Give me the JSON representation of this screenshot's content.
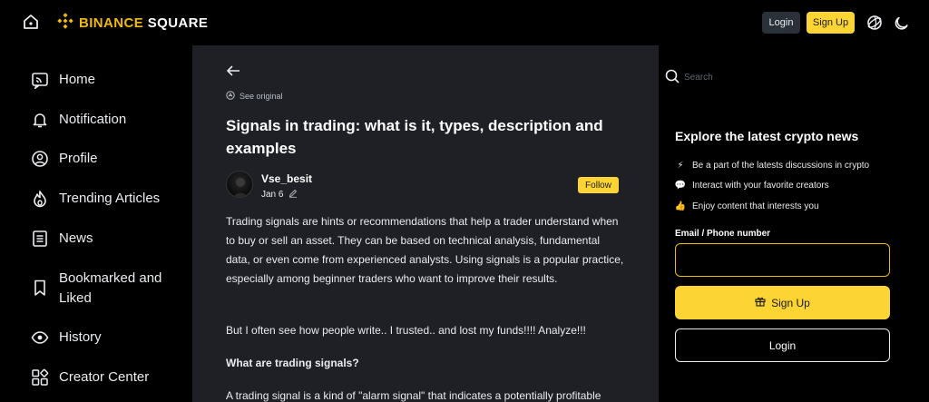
{
  "header": {
    "logo_brand": "BINANCE",
    "logo_product": "SQUARE",
    "login_label": "Login",
    "signup_label": "Sign Up",
    "icons": [
      "home-icon",
      "binance-logo-icon",
      "globe-icon",
      "moon-icon"
    ]
  },
  "sidebar": {
    "items": [
      {
        "label": "Home",
        "icon": "home-feed-icon"
      },
      {
        "label": "Notification",
        "icon": "bell-icon"
      },
      {
        "label": "Profile",
        "icon": "user-icon"
      },
      {
        "label": "Trending Articles",
        "icon": "flame-icon"
      },
      {
        "label": "News",
        "icon": "news-icon"
      },
      {
        "label": "Bookmarked and Liked",
        "icon": "bookmark-icon"
      },
      {
        "label": "History",
        "icon": "eye-icon"
      },
      {
        "label": "Creator Center",
        "icon": "grid-icon"
      }
    ]
  },
  "article": {
    "see_original": "See original",
    "title": "Signals in trading: what is it, types, description and examples",
    "author": "Vse_besit",
    "date": "Jan 6",
    "follow_label": "Follow",
    "paragraphs": [
      "Trading signals are hints or recommendations that help a trader understand when to buy or sell an asset. They can be based on technical analysis, fundamental data, or even come from experienced analysts. Using signals is a popular practice, especially among beginner traders who want to improve their results.",
      "But I often see how people write.. I trusted.. and lost my funds!!!! Analyze!!!",
      "What are trading signals?",
      "A trading signal is a kind of \"alarm signal\" that indicates a potentially profitable"
    ]
  },
  "right_panel": {
    "search_placeholder": "Search",
    "explore_title": "Explore the latest crypto news",
    "bullets": [
      {
        "icon": "⚡",
        "text": "Be a part of the latests discussions in crypto"
      },
      {
        "icon": "💬",
        "text": "Interact with your favorite creators"
      },
      {
        "icon": "👍",
        "text": "Enjoy content that interests you"
      }
    ],
    "email_label": "Email / Phone number",
    "email_value": "",
    "signup_label": "Sign Up",
    "login_label": "Login"
  },
  "colors": {
    "accent": "#fcd535",
    "brand": "#f0b90b",
    "background": "#000000",
    "content_bg": "#1e2026"
  }
}
